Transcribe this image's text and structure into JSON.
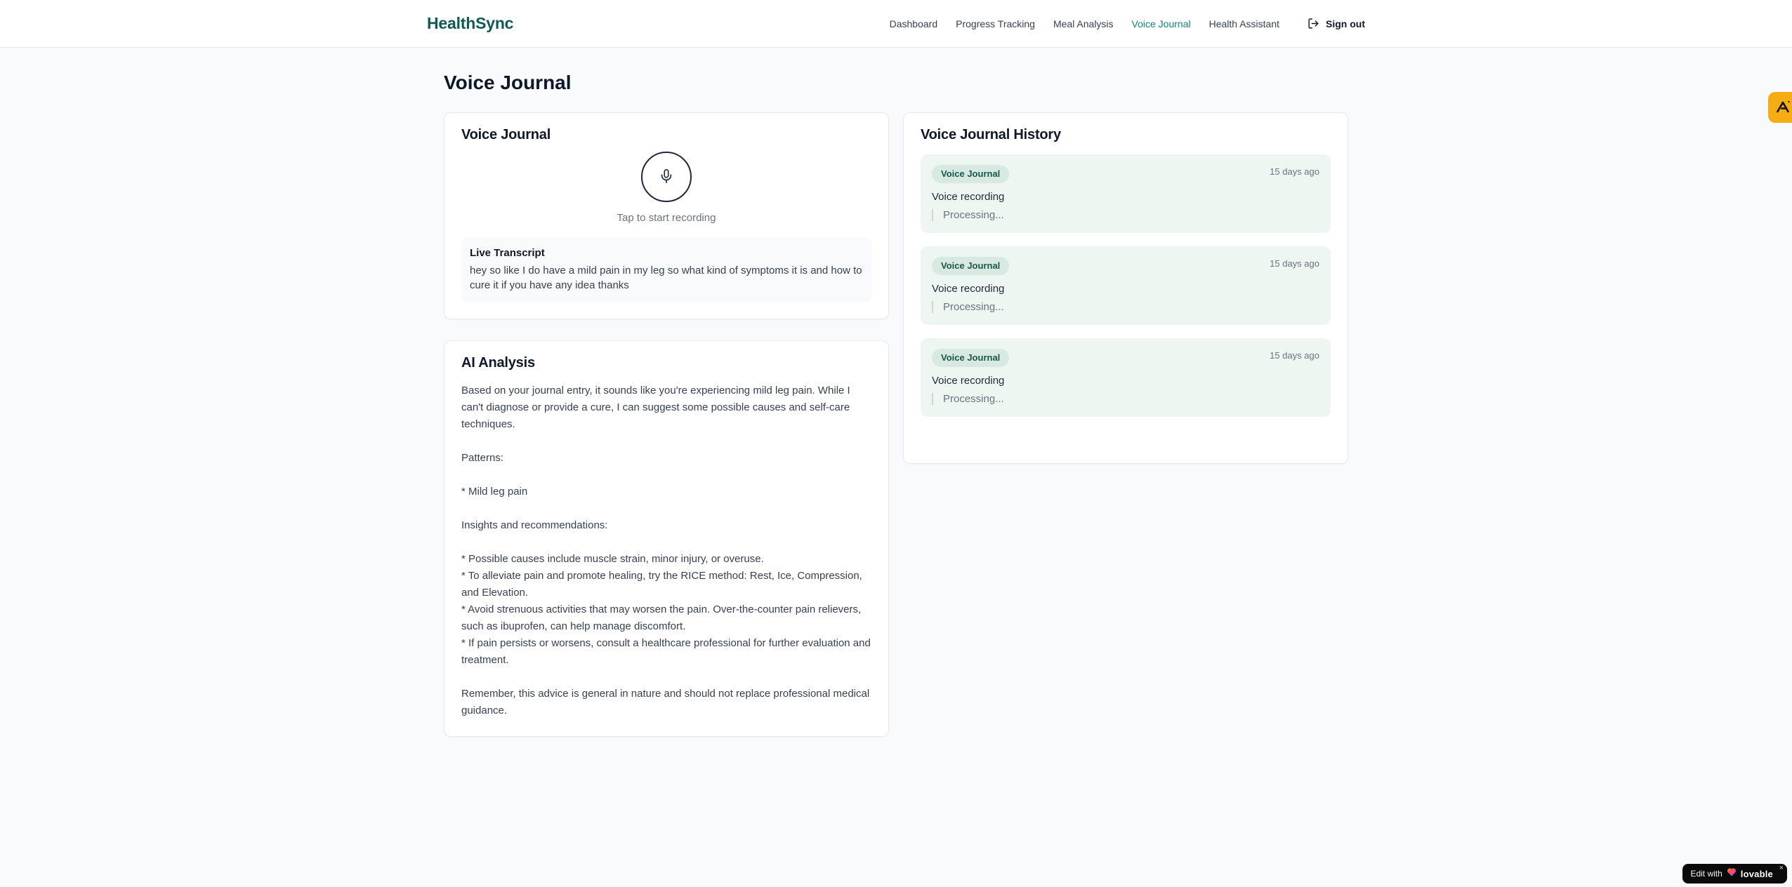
{
  "brand": {
    "name": "HealthSync"
  },
  "nav": {
    "items": [
      {
        "label": "Dashboard",
        "active": false
      },
      {
        "label": "Progress Tracking",
        "active": false
      },
      {
        "label": "Meal Analysis",
        "active": false
      },
      {
        "label": "Voice Journal",
        "active": true
      },
      {
        "label": "Health Assistant",
        "active": false
      }
    ],
    "sign_out_label": "Sign out"
  },
  "page": {
    "title": "Voice Journal"
  },
  "recorder": {
    "title": "Voice Journal",
    "tap_hint": "Tap to start recording",
    "transcript_title": "Live Transcript",
    "transcript_text": "hey so like I do have a mild pain in my leg so what kind of symptoms it is and how to cure it if you have any idea thanks"
  },
  "analysis": {
    "title": "AI Analysis",
    "body": "Based on your journal entry, it sounds like you're experiencing mild leg pain. While I can't diagnose or provide a cure, I can suggest some possible causes and self-care techniques.\n\nPatterns:\n\n* Mild leg pain\n\nInsights and recommendations:\n\n* Possible causes include muscle strain, minor injury, or overuse.\n* To alleviate pain and promote healing, try the RICE method: Rest, Ice, Compression, and Elevation.\n* Avoid strenuous activities that may worsen the pain. Over-the-counter pain relievers, such as ibuprofen, can help manage discomfort.\n* If pain persists or worsens, consult a healthcare professional for further evaluation and treatment.\n\nRemember, this advice is general in nature and should not replace professional medical guidance."
  },
  "history": {
    "title": "Voice Journal History",
    "entries": [
      {
        "badge": "Voice Journal",
        "time": "15 days ago",
        "description": "Voice recording",
        "status": "Processing..."
      },
      {
        "badge": "Voice Journal",
        "time": "15 days ago",
        "description": "Voice recording",
        "status": "Processing..."
      },
      {
        "badge": "Voice Journal",
        "time": "15 days ago",
        "description": "Voice recording",
        "status": "Processing..."
      }
    ]
  },
  "widgets": {
    "lovable": {
      "edit_prefix": "Edit with",
      "brand": "lovable",
      "close_label": "×"
    }
  },
  "colors": {
    "brand_teal": "#0d5c4f",
    "active_nav": "#0f8578",
    "entry_bg": "#eef6f1",
    "badge_bg": "#d7e9e0",
    "badge_text": "#19564c",
    "amber_widget": "#f6ac15",
    "page_bg": "#f8fafc"
  }
}
